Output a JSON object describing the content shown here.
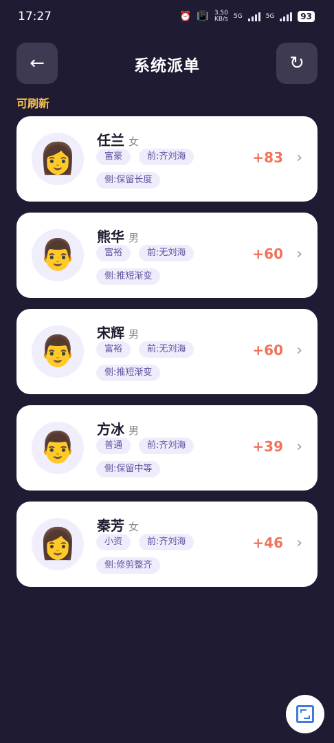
{
  "status_bar": {
    "time": "17:27",
    "speed": "3.50",
    "speed_unit": "KB/s",
    "net1": "5G",
    "net2": "5G",
    "battery": "93"
  },
  "header": {
    "back_icon": "←",
    "title": "系统派单",
    "refresh_icon": "↻"
  },
  "refresh_hint": "可刷新",
  "orders": [
    {
      "name": "任兰",
      "gender": "女",
      "avatar": "👩",
      "tag1": "富豪",
      "tag2": "前:齐刘海",
      "tag3": "侧:保留长度",
      "score": "+83"
    },
    {
      "name": "熊华",
      "gender": "男",
      "avatar": "👨",
      "tag1": "富裕",
      "tag2": "前:无刘海",
      "tag3": "侧:推短渐变",
      "score": "+60"
    },
    {
      "name": "宋辉",
      "gender": "男",
      "avatar": "👨",
      "tag1": "富裕",
      "tag2": "前:无刘海",
      "tag3": "侧:推短渐变",
      "score": "+60"
    },
    {
      "name": "方冰",
      "gender": "男",
      "avatar": "👨",
      "tag1": "普通",
      "tag2": "前:齐刘海",
      "tag3": "侧:保留中等",
      "score": "+39"
    },
    {
      "name": "秦芳",
      "gender": "女",
      "avatar": "👩",
      "tag1": "小资",
      "tag2": "前:齐刘海",
      "tag3": "侧:修剪整齐",
      "score": "+46"
    }
  ],
  "colors": {
    "background": "#1f1b33",
    "accent_yellow": "#f5c24c",
    "score": "#f0735b",
    "tag_bg": "#efedfb",
    "tag_text": "#5d52a0"
  },
  "icons": {
    "fab": "expand-window-icon",
    "chevron": "chevron-right-icon"
  }
}
